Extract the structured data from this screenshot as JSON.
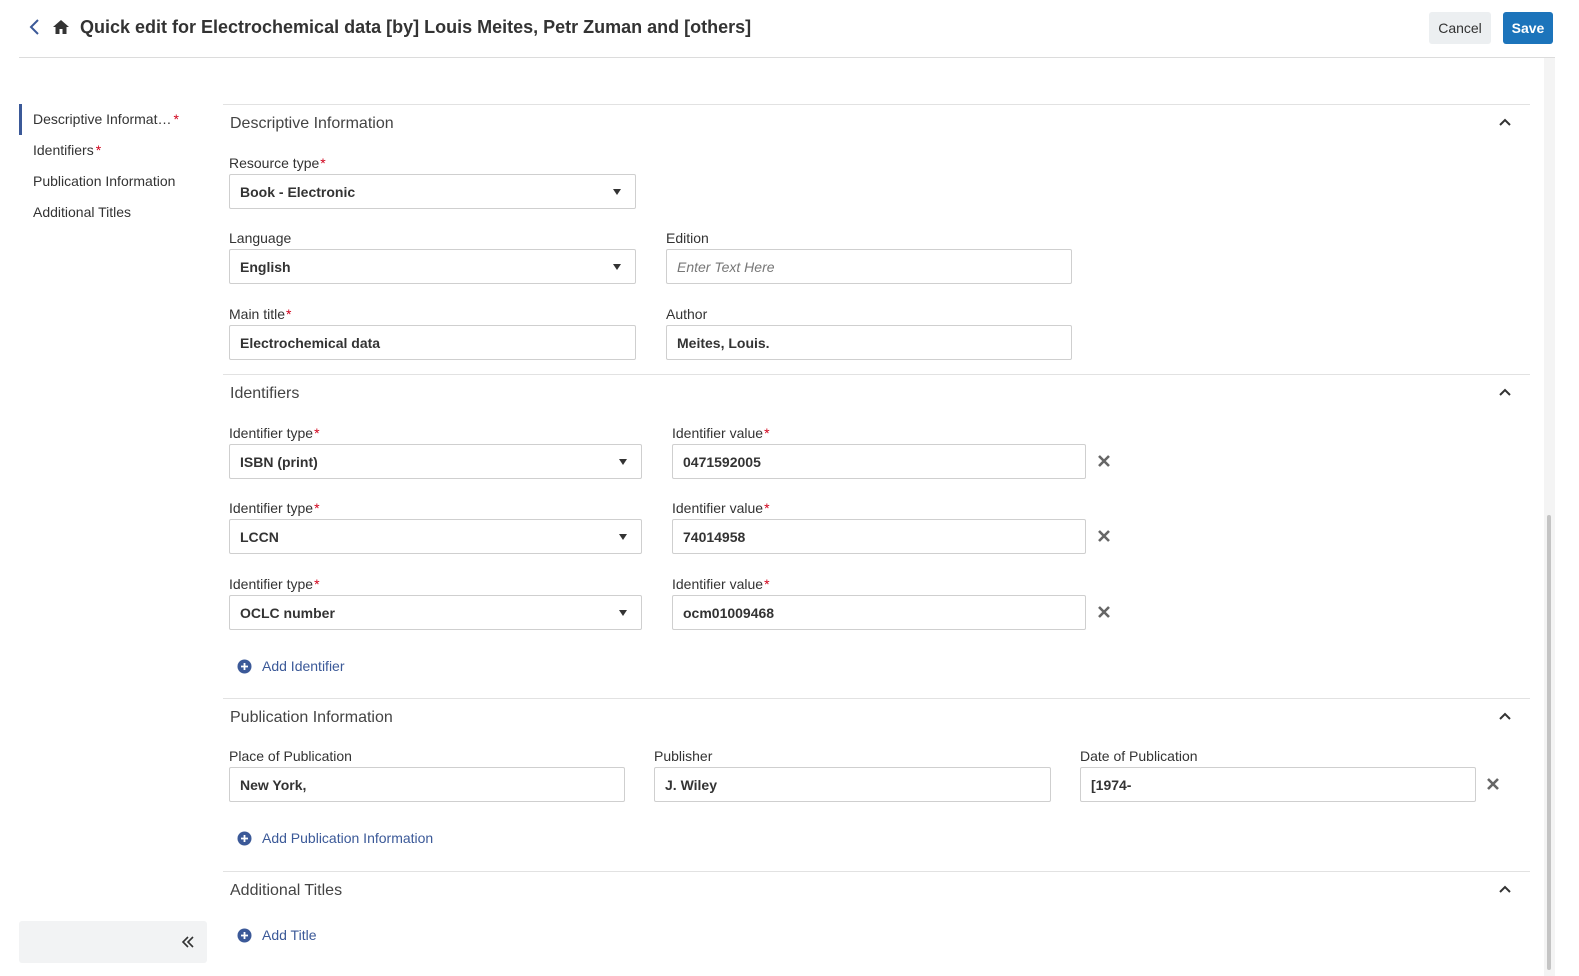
{
  "header": {
    "title": "Quick edit for Electrochemical data [by] Louis Meites, Petr Zuman and [others]",
    "cancel_label": "Cancel",
    "save_label": "Save"
  },
  "sidebar": {
    "items": [
      {
        "label": "Descriptive Informat…",
        "required": "*",
        "active": true
      },
      {
        "label": "Identifiers",
        "required": "*"
      },
      {
        "label": "Publication Information",
        "required": ""
      },
      {
        "label": "Additional Titles",
        "required": ""
      }
    ]
  },
  "descriptive": {
    "title": "Descriptive Information",
    "resource_type_label": "Resource type",
    "resource_type_value": "Book - Electronic",
    "language_label": "Language",
    "language_value": "English",
    "edition_label": "Edition",
    "edition_placeholder": "Enter Text Here",
    "main_title_label": "Main title",
    "main_title_value": "Electrochemical data",
    "author_label": "Author",
    "author_value": "Meites, Louis."
  },
  "identifiers": {
    "title": "Identifiers",
    "type_label": "Identifier type",
    "value_label": "Identifier value",
    "rows": [
      {
        "type": "ISBN (print)",
        "value": "0471592005"
      },
      {
        "type": "LCCN",
        "value": "74014958"
      },
      {
        "type": "OCLC number",
        "value": "ocm01009468"
      }
    ],
    "add_label": "Add Identifier"
  },
  "publication": {
    "title": "Publication Information",
    "place_label": "Place of Publication",
    "place_value": "New York,",
    "publisher_label": "Publisher",
    "publisher_value": "J. Wiley",
    "date_label": "Date of Publication",
    "date_value": "[1974-",
    "add_label": "Add Publication Information"
  },
  "additional_titles": {
    "title": "Additional Titles",
    "add_label": "Add Title"
  },
  "required_mark": "*",
  "colors": {
    "accent": "#1c74bb",
    "link": "#3b5998",
    "required": "#d0021b"
  }
}
